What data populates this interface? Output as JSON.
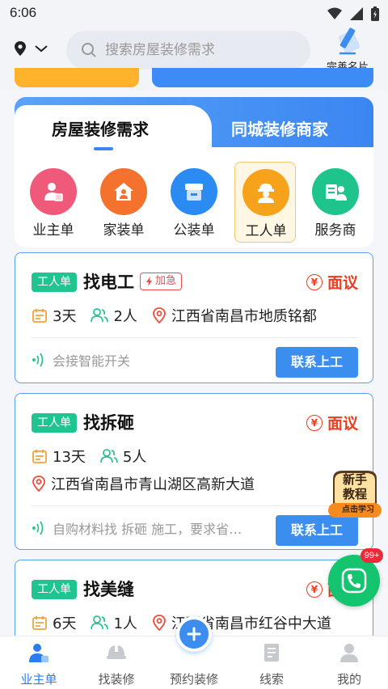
{
  "status_bar": {
    "time": "6:06"
  },
  "header": {
    "search_placeholder": "搜索房屋装修需求",
    "card_button_label": "完善名片"
  },
  "demand_panel": {
    "tabs": [
      {
        "label": "房屋装修需求",
        "active": true
      },
      {
        "label": "同城装修商家",
        "active": false
      }
    ],
    "categories": [
      {
        "label": "业主单",
        "icon": "owner-icon",
        "color": "#f05a7a",
        "selected": false
      },
      {
        "label": "家装单",
        "icon": "home-icon",
        "color": "#f5722e",
        "selected": false
      },
      {
        "label": "公装单",
        "icon": "store-icon",
        "color": "#2b8bf2",
        "selected": false
      },
      {
        "label": "工人单",
        "icon": "worker-icon",
        "color": "#f7a21b",
        "selected": true
      },
      {
        "label": "服务商",
        "icon": "service-provider-icon",
        "color": "#1fc38c",
        "selected": false
      }
    ]
  },
  "jobs": [
    {
      "tag": "工人单",
      "title": "找电工",
      "urgent_label": "加急",
      "price": "面议",
      "duration": "3天",
      "people": "2人",
      "location": "江西省南昌市地质铭都",
      "description": "会接智能开关",
      "contact_label": "联系上工"
    },
    {
      "tag": "工人单",
      "title": "找拆砸",
      "price": "面议",
      "duration": "13天",
      "people": "5人",
      "location": "江西省南昌市青山湖区高新大道",
      "description": "自购材料找 拆砸 施工，要求省…",
      "contact_label": "联系上工"
    },
    {
      "tag": "工人单",
      "title": "找美缝",
      "price": "面议",
      "duration": "6天",
      "people": "1人",
      "location": "江西省南昌市红谷中大道"
    }
  ],
  "floating": {
    "tutorial_title": "新手教程",
    "tutorial_sub": "点击学习",
    "phone_badge": "99+"
  },
  "bottom_nav": {
    "items": [
      {
        "label": "业主单",
        "active": true
      },
      {
        "label": "找装修",
        "active": false
      },
      {
        "label": "预约装修",
        "active": false
      },
      {
        "label": "线索",
        "active": false
      },
      {
        "label": "我的",
        "active": false
      }
    ]
  },
  "colors": {
    "accent": "#3b8ef0",
    "price_red": "#ef3b1e",
    "tag_green": "#20c490"
  }
}
